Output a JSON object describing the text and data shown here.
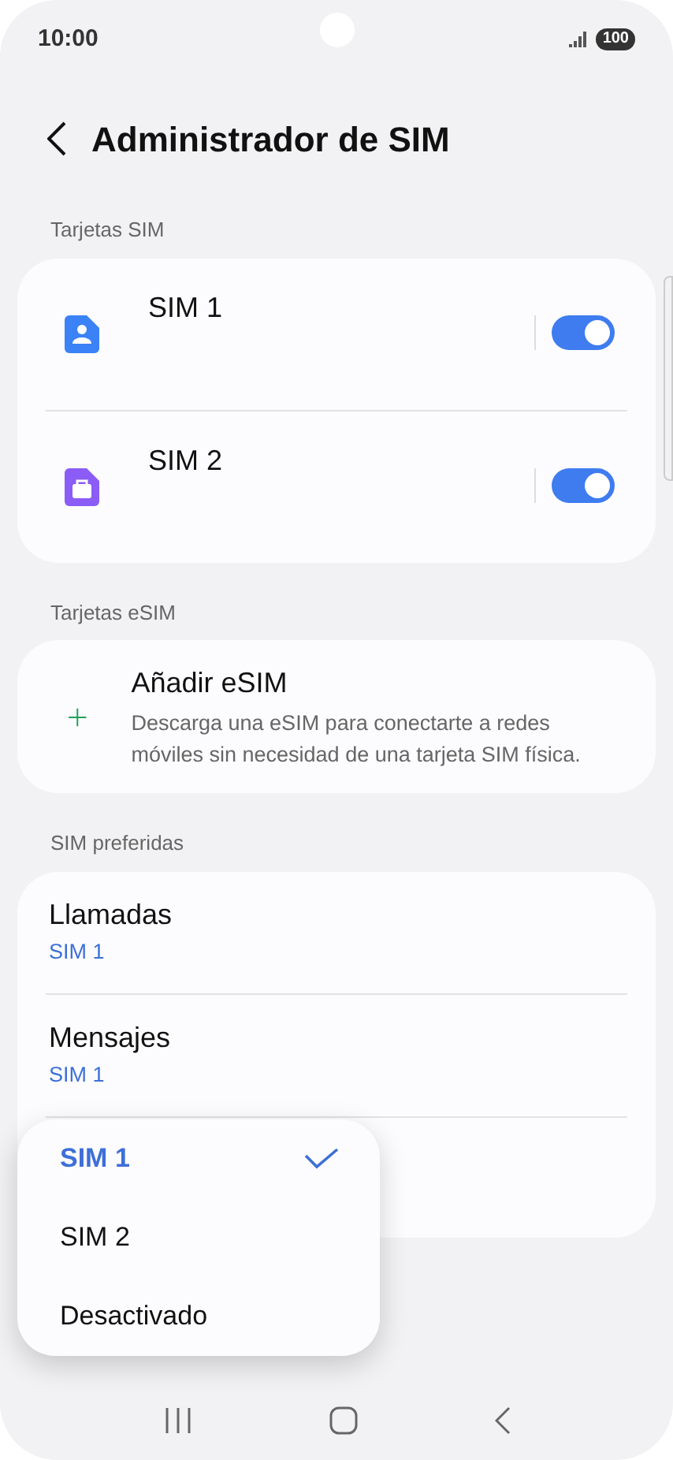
{
  "status_bar": {
    "time": "10:00",
    "battery": "100"
  },
  "header": {
    "title": "Administrador de SIM"
  },
  "sections": [
    {
      "title": "Tarjetas SIM",
      "kind": "sims",
      "items": [
        {
          "name": "SIM 1",
          "color": "#3b82f6",
          "kind": "personal",
          "on": true
        },
        {
          "name": "SIM 2",
          "color": "#8b5cf6",
          "kind": "work",
          "on": true
        }
      ]
    },
    {
      "title": "Tarjetas eSIM",
      "kind": "add",
      "items": [
        {
          "name": "Añadir eSIM",
          "description": "Descarga una eSIM para conectarte a redes móviles sin necesidad de una tarjeta SIM física."
        }
      ]
    },
    {
      "title": "SIM preferidas",
      "kind": "prefs",
      "items": [
        {
          "name": "Llamadas",
          "value": "SIM 1"
        },
        {
          "name": "Mensajes",
          "value": "SIM 1"
        }
      ]
    }
  ],
  "popup_menu": [
    {
      "label": "SIM 1",
      "selected": true
    },
    {
      "label": "SIM 2",
      "selected": false
    },
    {
      "label": "Desactivado",
      "selected": false
    }
  ]
}
